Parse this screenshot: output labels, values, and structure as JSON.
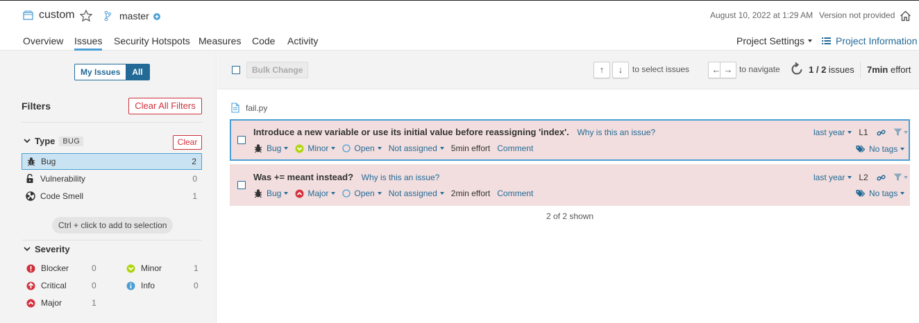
{
  "header": {
    "project_name": "custom",
    "branch": "master",
    "analysis_date": "August 10, 2022 at 1:29 AM",
    "version": "Version not provided",
    "tabs": [
      {
        "label": "Overview"
      },
      {
        "label": "Issues",
        "active": true
      },
      {
        "label": "Security Hotspots"
      },
      {
        "label": "Measures"
      },
      {
        "label": "Code"
      },
      {
        "label": "Activity"
      }
    ],
    "project_settings": "Project Settings",
    "project_information": "Project Information"
  },
  "sidebar": {
    "toggle": {
      "my_issues": "My Issues",
      "all": "All"
    },
    "filters_title": "Filters",
    "clear_all": "Clear All Filters",
    "type_facet": {
      "title": "Type",
      "badge": "BUG",
      "clear": "Clear",
      "items": [
        {
          "label": "Bug",
          "count": "2",
          "icon": "bug-icon",
          "selected": true
        },
        {
          "label": "Vulnerability",
          "count": "0",
          "icon": "lock-icon"
        },
        {
          "label": "Code Smell",
          "count": "1",
          "icon": "code-smell-icon"
        }
      ]
    },
    "hint": "Ctrl + click to add to selection",
    "severity_facet": {
      "title": "Severity",
      "items": [
        {
          "label": "Blocker",
          "count": "0",
          "icon": "blocker-icon",
          "color": "#d02f3a"
        },
        {
          "label": "Minor",
          "count": "1",
          "icon": "minor-icon",
          "color": "#b0d513"
        },
        {
          "label": "Critical",
          "count": "0",
          "icon": "critical-icon",
          "color": "#d4333f"
        },
        {
          "label": "Info",
          "count": "0",
          "icon": "info-icon",
          "color": "#4b9fd5"
        },
        {
          "label": "Major",
          "count": "1",
          "icon": "major-icon",
          "color": "#d4333f"
        }
      ]
    }
  },
  "toolbar": {
    "bulk_change": "Bulk Change",
    "select_hint": "to select issues",
    "navigate_hint": "to navigate",
    "count": "1 / 2",
    "count_suffix": "issues",
    "effort": "7min",
    "effort_suffix": "effort"
  },
  "file": {
    "name": "fail.py"
  },
  "issues": [
    {
      "message": "Introduce a new variable or use its initial value before reassigning 'index'.",
      "why": "Why is this an issue?",
      "type": "Bug",
      "severity": "Minor",
      "status": "Open",
      "assignee": "Not assigned",
      "effort": "5min effort",
      "comment": "Comment",
      "date": "last year",
      "line": "L1",
      "tags": "No tags"
    },
    {
      "message": "Was += meant instead?",
      "why": "Why is this an issue?",
      "type": "Bug",
      "severity": "Major",
      "status": "Open",
      "assignee": "Not assigned",
      "effort": "2min effort",
      "comment": "Comment",
      "date": "last year",
      "line": "L2",
      "tags": "No tags"
    }
  ],
  "footer": {
    "shown": "2 of 2 shown"
  },
  "colors": {
    "accent": "#236a97",
    "issue_bg": "#f2dede",
    "sidebar_bg": "#f3f3f3",
    "selected_facet": "#cae3f2"
  }
}
